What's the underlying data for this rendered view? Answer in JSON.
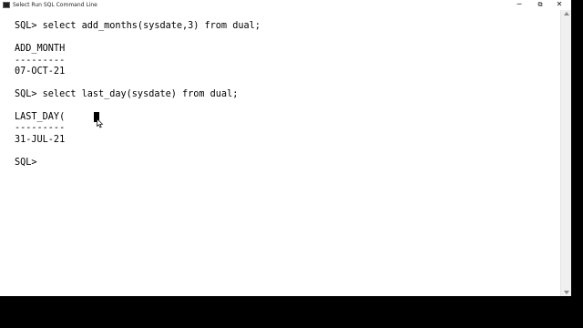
{
  "window": {
    "title": "Select Run SQL Command Line",
    "controls": {
      "minimize": "─",
      "maximize": "⧉",
      "close": "✕"
    }
  },
  "console": {
    "lines": [
      "SQL> select add_months(sysdate,3) from dual;",
      "ADD_MONTH",
      "---------",
      "07-OCT-21",
      "SQL> select last_day(sysdate) from dual;",
      "LAST_DAY(",
      "---------",
      "31-JUL-21",
      "SQL>"
    ]
  },
  "colors": {
    "background": "#ffffff",
    "text": "#000000",
    "outside": "#000000"
  },
  "icons": {
    "app": "console-app-icon",
    "pointer": "mouse-pointer-icon"
  }
}
